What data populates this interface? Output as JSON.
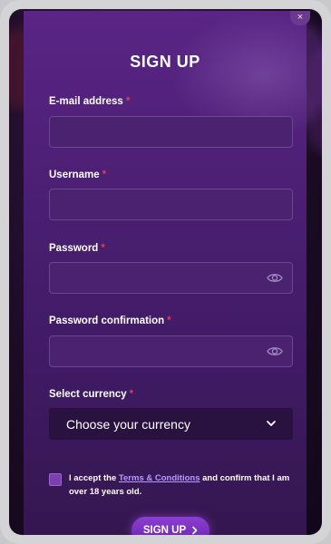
{
  "modal": {
    "title": "SIGN UP",
    "close_icon": "close-icon"
  },
  "form": {
    "email": {
      "label": "E-mail address",
      "required": "*",
      "value": "",
      "placeholder": ""
    },
    "username": {
      "label": "Username",
      "required": "*",
      "value": "",
      "placeholder": ""
    },
    "password": {
      "label": "Password",
      "required": "*",
      "value": "",
      "placeholder": "",
      "icon": "eye-icon"
    },
    "password_confirmation": {
      "label": "Password confirmation",
      "required": "*",
      "value": "",
      "placeholder": "",
      "icon": "eye-icon"
    },
    "currency": {
      "label": "Select currency",
      "required": "*",
      "selected": "Choose your currency",
      "icon": "chevron-down-icon"
    }
  },
  "consent": {
    "prefix": "I accept the",
    "link": "Terms & Conditions",
    "suffix": "and confirm that I am over 18 years old.",
    "checked": false
  },
  "submit": {
    "label": "SIGN UP",
    "icon": "chevron-right-icon"
  },
  "colors": {
    "accent": "#7a3fb0",
    "required": "#e2395b",
    "link": "#b79bff",
    "modal": "#4b1f73"
  }
}
